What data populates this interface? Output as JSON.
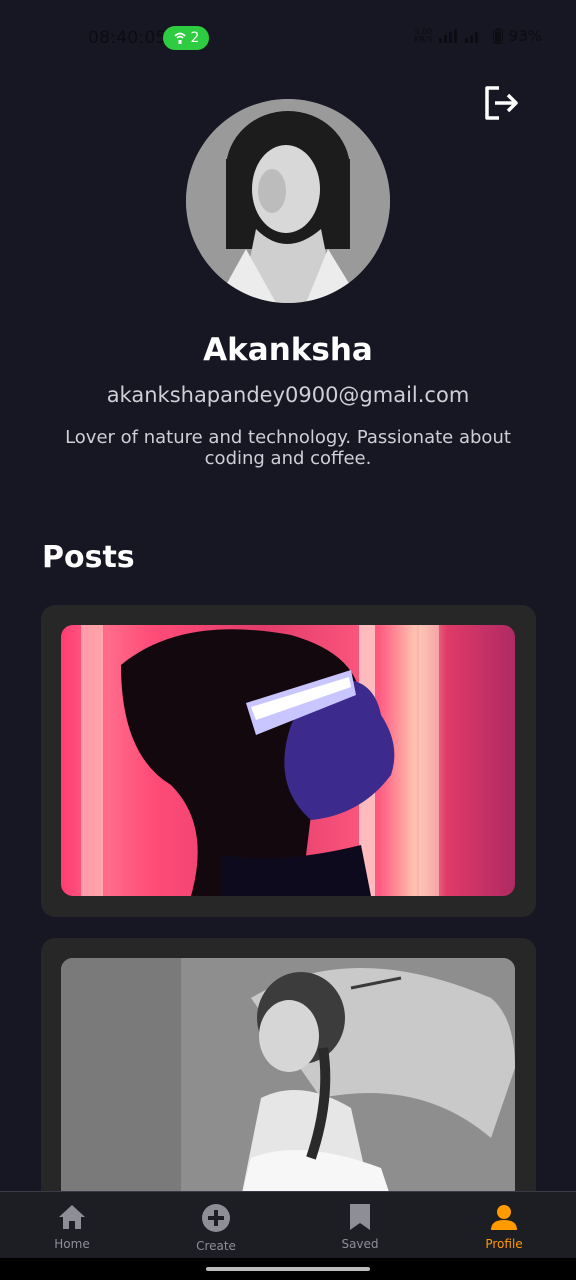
{
  "status_bar": {
    "time": "08:40:05",
    "hotspot_count": "2",
    "net_speed_value": "5.00",
    "net_speed_unit": "KB/S",
    "battery": "93%"
  },
  "profile": {
    "name": "Akanksha",
    "email": "akankshapandey0900@gmail.com",
    "bio": "Lover of nature and technology. Passionate about coding and coffee."
  },
  "posts_section": {
    "title": "Posts"
  },
  "bottom_nav": {
    "items": [
      {
        "label": "Home",
        "icon": "home-icon"
      },
      {
        "label": "Create",
        "icon": "add-circle-icon"
      },
      {
        "label": "Saved",
        "icon": "bookmark-icon"
      },
      {
        "label": "Profile",
        "icon": "person-icon"
      }
    ],
    "active": "Profile",
    "accent_color": "#ff9a00"
  }
}
